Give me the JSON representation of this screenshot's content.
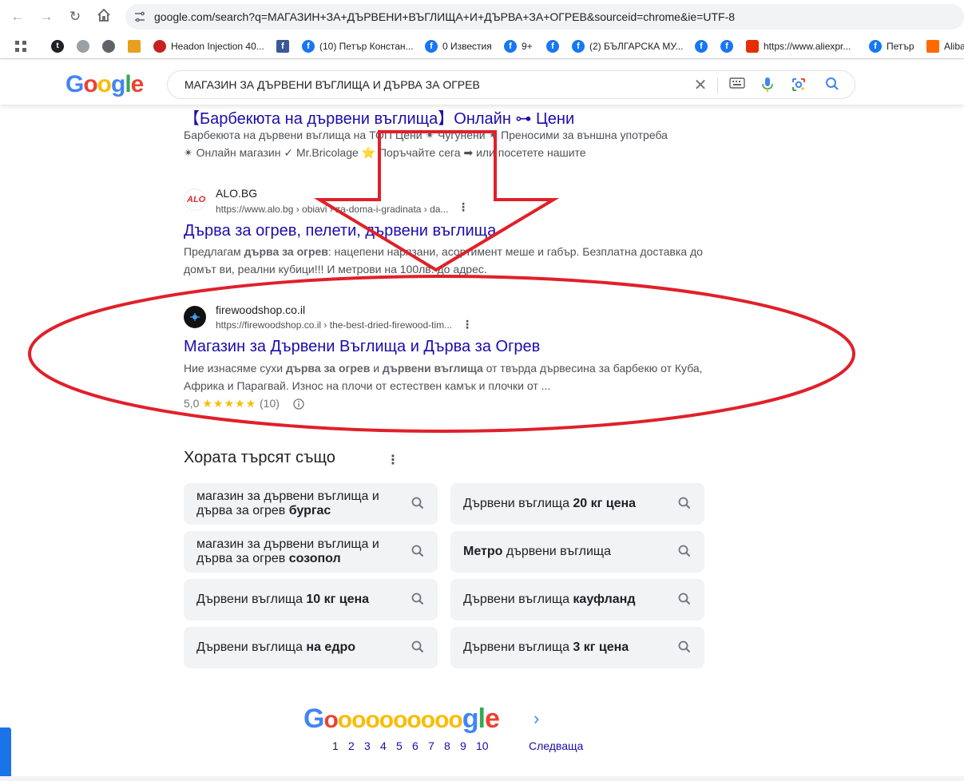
{
  "browser": {
    "url": "google.com/search?q=МАГАЗИН+ЗА+ДЪРВЕНИ+ВЪГЛИЩА+И+ДЪРВА+ЗА+ОГРЕВ&sourceid=chrome&ie=UTF-8",
    "bookmarks": [
      {
        "label": "Headon Injection 40..."
      },
      {
        "label": "(10) Петър Констан..."
      },
      {
        "label": "0 Известия"
      },
      {
        "label": "9+"
      },
      {
        "label": "(2) БЪЛГАРСКА МУ..."
      },
      {
        "label": "https://www.aliexpr..."
      },
      {
        "label": "Петър"
      },
      {
        "label": "Aliba"
      }
    ]
  },
  "google": {
    "logo": "Google",
    "query": "МАГАЗИН ЗА ДЪРВЕНИ ВЪГЛИЩА И ДЪРВА ЗА ОГРЕВ"
  },
  "results": [
    {
      "title": "【Барбекюта на дървени въглища】Онлайн ⊶ Цени",
      "snippet_line1": "Барбекюта на дървени въглища на ТОП Цени ✴ Чугунени ✴ Преносими за външна употреба",
      "snippet_line2": "✴ Онлайн магазин ✓ Mr.Bricolage ⭐ Поръчайте сега ➡ или посетете нашите"
    },
    {
      "site": "ALO.BG",
      "favicon_text": "ALO",
      "url": "https://www.alo.bg › obiavi › za-doma-i-gradinata › da...",
      "title": "Дърва за огрев, пелети, дървени въглища",
      "snippet_line1_pre": "Предлагам ",
      "snippet_line1_bold": "дърва за огрев",
      "snippet_line1_post": ": нацепени нарязани, асортимент меше и габър. Безплатна доставка до",
      "snippet_line2": "домът ви, реални кубици!!! И метрови на 100лв. до адрес."
    },
    {
      "site": "firewoodshop.co.il",
      "url": "https://firewoodshop.co.il › the-best-dried-firewood-tim...",
      "title": "Магазин за Дървени Въглища и Дърва за Огрев",
      "snippet_line1_pre": "Ние изнасяме сухи ",
      "snippet_line1_bold1": "дърва за огрев",
      "snippet_line1_mid": " и ",
      "snippet_line1_bold2": "дървени въглища",
      "snippet_line1_post": " от твърда дървесина за барбекю от Куба,",
      "snippet_line2": "Африка и Парагвай. Износ на плочи от естествен камък и плочки от ...",
      "rating_value": "5,0",
      "stars": "★★★★★",
      "rating_count": "(10)"
    }
  ],
  "people_also_search": {
    "title": "Хората търсят също",
    "chips": [
      {
        "pre": "магазин за дървени въглища и дърва за огрев ",
        "bold": "бургас",
        "post": ""
      },
      {
        "pre": "Дървени въглища ",
        "bold": "20 кг цена",
        "post": ""
      },
      {
        "pre": "магазин за дървени въглища и дърва за огрев ",
        "bold": "созопол",
        "post": ""
      },
      {
        "pre": "",
        "bold": "Метро",
        "post": " дървени въглища"
      },
      {
        "pre": "Дървени въглища ",
        "bold": "10 кг цена",
        "post": ""
      },
      {
        "pre": "Дървени въглища ",
        "bold": "кауфланд",
        "post": ""
      },
      {
        "pre": "Дървени въглища ",
        "bold": "на едро",
        "post": ""
      },
      {
        "pre": "Дървени въглища ",
        "bold": "3 кг цена",
        "post": ""
      }
    ]
  },
  "pagination": {
    "logo_letters": [
      "G",
      "o",
      "o",
      "o",
      "o",
      "o",
      "o",
      "o",
      "o",
      "o",
      "o",
      "g",
      "l",
      "e"
    ],
    "pages": [
      "1",
      "2",
      "3",
      "4",
      "5",
      "6",
      "7",
      "8",
      "9",
      "10"
    ],
    "current": "1",
    "next_label": "Следваща"
  },
  "colors": {
    "link": "#1a0dab",
    "annotation": "#e0202a",
    "google_blue": "#4285f4",
    "google_red": "#ea4335",
    "google_yellow": "#fbbc05",
    "google_green": "#34a853"
  }
}
